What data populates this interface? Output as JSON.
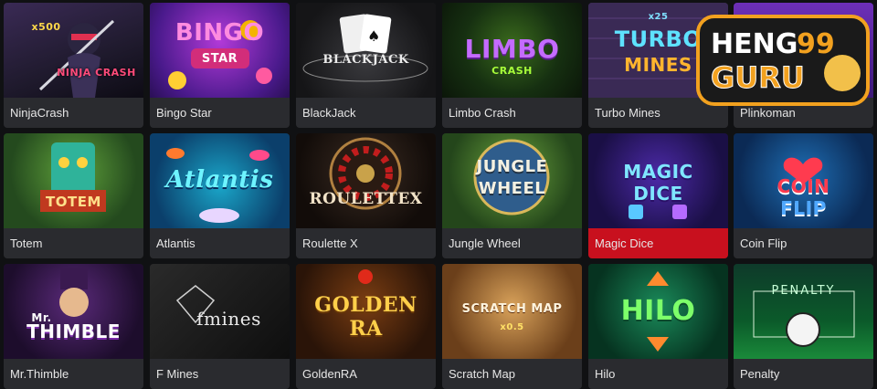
{
  "games": [
    {
      "title": "NinjaCrash",
      "art_text": "NINJA CRASH",
      "badge": "x500"
    },
    {
      "title": "Bingo Star",
      "art_text": "BINGO",
      "art_sub": "STAR"
    },
    {
      "title": "BlackJack",
      "art_text": "BLACKJACK"
    },
    {
      "title": "Limbo Crash",
      "art_text": "LIMBO",
      "art_sub": "CRASH"
    },
    {
      "title": "Turbo Mines",
      "art_text": "TURBO",
      "art_sub": "MINES",
      "badge": "x25"
    },
    {
      "title": "Plinkoman",
      "art_text": ""
    },
    {
      "title": "Totem",
      "art_text": "TOTEM"
    },
    {
      "title": "Atlantis",
      "art_text": "Atlantis"
    },
    {
      "title": "Roulette X",
      "art_text": "ROULETTEX"
    },
    {
      "title": "Jungle Wheel",
      "art_text": "JUNGLE",
      "art_sub": "WHEEL"
    },
    {
      "title": "Magic Dice",
      "art_text": "MAGIC",
      "art_sub": "DICE"
    },
    {
      "title": "Coin Flip",
      "art_text": "COIN",
      "art_sub": "FLIP"
    },
    {
      "title": "Mr.Thimble",
      "art_text": "Mr.",
      "art_sub": "THIMBLE"
    },
    {
      "title": "F Mines",
      "art_text": "fmines"
    },
    {
      "title": "GoldenRA",
      "art_text": "GOLDEN",
      "art_sub": "RA"
    },
    {
      "title": "Scratch Map",
      "art_text": "SCRATCH MAP",
      "badge": "x0.5"
    },
    {
      "title": "Hilo",
      "art_text": "HILO"
    },
    {
      "title": "Penalty",
      "art_text": "PENALTY"
    }
  ],
  "active_game": "Magic Dice",
  "watermark": {
    "line1": "HENG",
    "num": "99",
    "line2": "GURU"
  },
  "colors": {
    "active": "#c8101e",
    "caption": "#2a2b2f",
    "background": "#101113"
  }
}
